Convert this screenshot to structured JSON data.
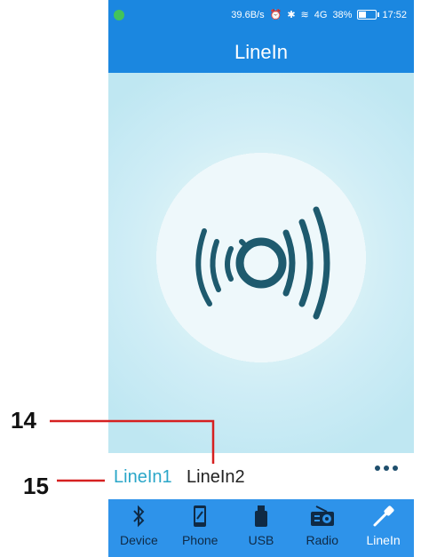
{
  "status": {
    "speed": "39.6B/s",
    "battery": "38%",
    "battery_level": 0.38,
    "time": "17:52",
    "network": "4G"
  },
  "header": {
    "title": "LineIn"
  },
  "tabs": [
    {
      "label": "LineIn1",
      "active": true
    },
    {
      "label": "LineIn2",
      "active": false
    }
  ],
  "nav": [
    {
      "label": "Device",
      "icon": "bluetooth-icon"
    },
    {
      "label": "Phone",
      "icon": "phone-icon"
    },
    {
      "label": "USB",
      "icon": "usb-icon"
    },
    {
      "label": "Radio",
      "icon": "radio-icon"
    },
    {
      "label": "LineIn",
      "icon": "linein-icon",
      "active": true
    }
  ],
  "callouts": [
    {
      "label": "14"
    },
    {
      "label": "15"
    }
  ],
  "colors": {
    "primary": "#1b87e0",
    "nav_bg": "#2e93ea",
    "active_tab": "#2aa6c8",
    "icon_dark": "#1e5a6e"
  }
}
